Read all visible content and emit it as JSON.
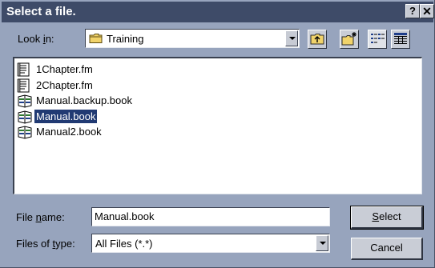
{
  "window": {
    "title": "Select a file.",
    "help_glyph": "?",
    "close_glyph": "✕"
  },
  "look_in": {
    "label_pre": "Look ",
    "label_key": "i",
    "label_post": "n:",
    "value": "Training"
  },
  "files": [
    {
      "name": "1Chapter.fm",
      "icon": "frame-document-icon",
      "selected": false
    },
    {
      "name": "2Chapter.fm",
      "icon": "frame-document-icon",
      "selected": false
    },
    {
      "name": "Manual.backup.book",
      "icon": "book-icon",
      "selected": false
    },
    {
      "name": "Manual.book",
      "icon": "book-icon",
      "selected": true
    },
    {
      "name": "Manual2.book",
      "icon": "book-icon",
      "selected": false
    }
  ],
  "file_name": {
    "label_pre": "File ",
    "label_key": "n",
    "label_post": "ame:",
    "value": "Manual.book"
  },
  "file_type": {
    "label_pre": "Files of ",
    "label_key": "t",
    "label_post": "ype:",
    "value": "All Files (*.*)"
  },
  "buttons": {
    "select_key": "S",
    "select_rest": "elect",
    "cancel": "Cancel"
  },
  "colors": {
    "dialog_bg": "#97a4bd",
    "titlebar": "#3e4b68",
    "selection": "#213a73"
  }
}
